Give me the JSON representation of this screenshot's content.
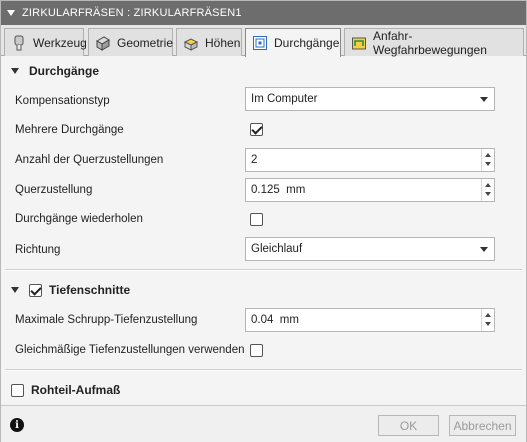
{
  "window": {
    "title": "ZIRKULARFRÄSEN : ZIRKULARFRÄSEN1"
  },
  "tabs": [
    {
      "label": "Werkzeug",
      "icon": "tool-icon"
    },
    {
      "label": "Geometrie",
      "icon": "geometry-icon"
    },
    {
      "label": "Höhen",
      "icon": "heights-icon"
    },
    {
      "label": "Durchgänge",
      "icon": "passes-icon",
      "active": true
    },
    {
      "label": "Anfahr-Wegfahrbewegungen",
      "icon": "linking-icon"
    }
  ],
  "passes": {
    "header": "Durchgänge",
    "compensation_label": "Kompensationstyp",
    "compensation_value": "Im Computer",
    "multiple_passes_label": "Mehrere Durchgänge",
    "multiple_passes_checked": true,
    "stepover_count_label": "Anzahl der Querzustellungen",
    "stepover_count_value": "2",
    "stepover_label": "Querzustellung",
    "stepover_value": "0.125  mm",
    "repeat_passes_label": "Durchgänge wiederholen",
    "repeat_passes_checked": false,
    "direction_label": "Richtung",
    "direction_value": "Gleichlauf"
  },
  "depth": {
    "header": "Tiefenschnitte",
    "enabled": true,
    "max_roughing_label": "Maximale Schrupp-Tiefenzustellung",
    "max_roughing_value": "0.04  mm",
    "even_stepdown_label": "Gleichmäßige Tiefenzustellungen verwenden",
    "even_stepdown_checked": false
  },
  "stock": {
    "header": "Rohteil-Aufmaß",
    "enabled": false
  },
  "footer": {
    "ok_label": "OK",
    "cancel_label": "Abbrechen"
  }
}
